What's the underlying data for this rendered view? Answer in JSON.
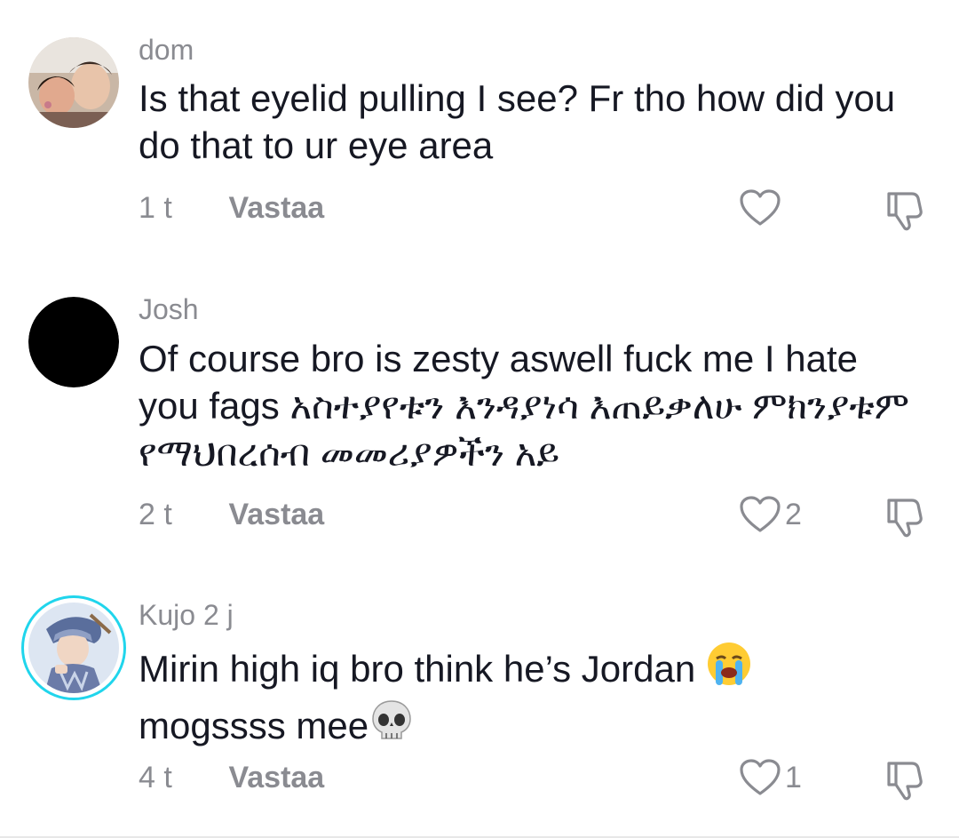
{
  "comments": [
    {
      "username": "dom",
      "text": "Is that eyelid pulling I see? Fr tho how did you do that to ur eye area",
      "time": "1 t",
      "reply_label": "Vastaa",
      "likes": "",
      "avatar_icon": "photo-avatar"
    },
    {
      "username": "Josh",
      "text": "Of course bro is zesty aswell fuck me I hate you fags አስተያየቱን እንዳያነሳ እጠይቃለሁ ምክንያቱም የማህበረሰብ መመሪያዎችን አይ",
      "time": "2 t",
      "reply_label": "Vastaa",
      "likes": "2",
      "avatar_icon": "black-circle-avatar"
    },
    {
      "username": "Kujo 2 j",
      "text_part1": "Mirin high iq bro think he’s Jordan ",
      "text_part2": "mogssss mee",
      "emoji1": "loudly-crying-face-emoji",
      "emoji2": "skull-emoji",
      "time": "4 t",
      "reply_label": "Vastaa",
      "likes": "1",
      "avatar_icon": "anime-character-avatar",
      "avatar_ring_color": "#20d5ec"
    }
  ],
  "colors": {
    "secondary_text": "#8a8b91",
    "primary_text": "#161823",
    "story_ring": "#20d5ec"
  }
}
